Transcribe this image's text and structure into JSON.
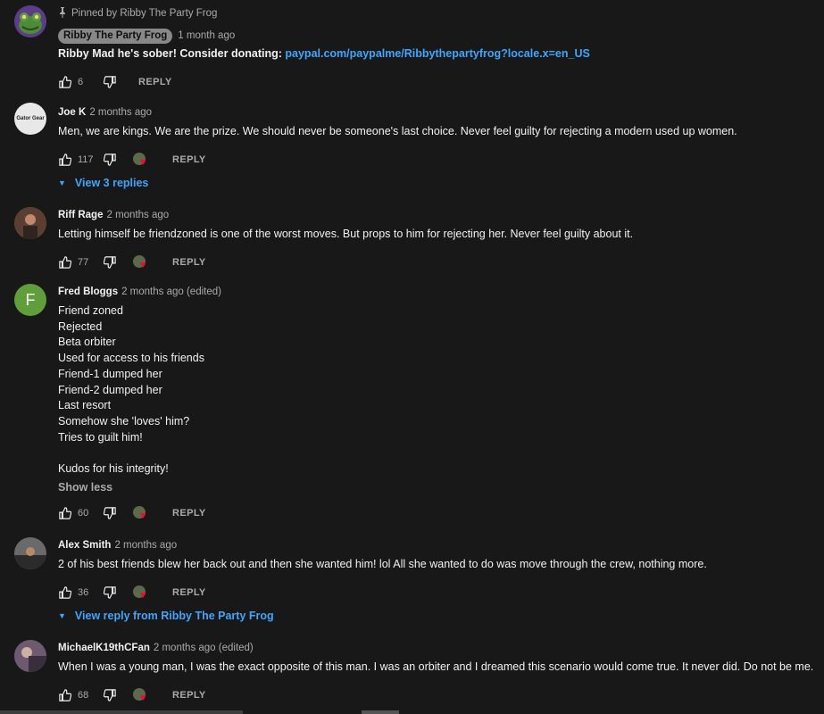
{
  "comments": [
    {
      "pinned_text": "Pinned by Ribby The Party Frog",
      "author": "Ribby The Party Frog",
      "time": "1 month ago",
      "text_prefix": "Ribby Mad he's sober! Consider donating: ",
      "link": "paypal.com/paypalme/Ribbythepartyfrog?locale.x=en_US",
      "likes": "6",
      "reply": "REPLY"
    },
    {
      "author": "Joe K",
      "time": "2 months ago",
      "text": "Men, we are kings. We are the prize. We should never be someone's last choice. Never feel guilty for rejecting a modern used up women.",
      "likes": "117",
      "reply": "REPLY",
      "avatar_text": "Gator Gear",
      "view_replies": "View 3 replies"
    },
    {
      "author": "Riff Rage",
      "time": "2 months ago",
      "text": "Letting himself be friendzoned is one of the worst moves. But props to him for rejecting her. Never feel guilty about it.",
      "likes": "77",
      "reply": "REPLY"
    },
    {
      "author": "Fred Bloggs",
      "time": "2 months ago (edited)",
      "avatar_letter": "F",
      "text": "Friend zoned\nRejected\nBeta orbiter\nUsed for access to his friends\nFriend-1 dumped her\nFriend-2 dumped her\nLast resort\nSomehow she 'loves' him?\nTries to guilt him!\n\nKudos for his integrity!",
      "show_less": "Show less",
      "likes": "60",
      "reply": "REPLY"
    },
    {
      "author": "Alex Smith",
      "time": "2 months ago",
      "text": "2 of his best friends blew her back out and then she wanted him! lol All she wanted to do was move through the crew, nothing more.",
      "likes": "36",
      "reply": "REPLY",
      "view_replies": "View reply from Ribby The Party Frog"
    },
    {
      "author": "MichaelK19thCFan",
      "time": "2 months ago (edited)",
      "text": "When I was a young man, I was the exact opposite of this man. I was an orbiter and I dreamed this scenario would come true. It never did.  Do not be me.",
      "likes": "68",
      "reply": "REPLY"
    }
  ],
  "colors": {
    "background": "#181818",
    "link": "#3ea6ff",
    "heart": "#ff0033",
    "secondary_text": "#aaaaaa"
  }
}
